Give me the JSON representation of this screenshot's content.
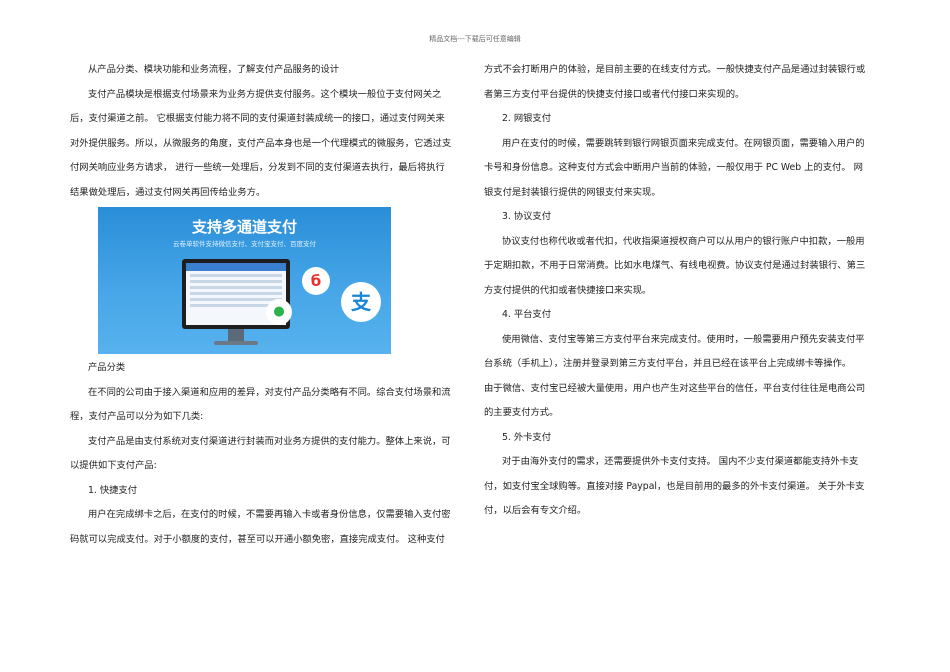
{
  "header": "精品文档---下载后可任意编辑",
  "left": [
    "从产品分类、模块功能和业务流程，了解支付产品服务的设计",
    "支付产品模块是根据支付场景来为业务方提供支付服务。这个模块一般位于支付网关之",
    "后，支付渠道之前。 它根据支付能力将不同的支付渠道封装成统一的接口，通过支付网关来",
    "对外提供服务。所以，从微服务的角度，支付产品本身也是一个代理模式的微服务，它透过支",
    "付网关响应业务方请求， 进行一些统一处理后，分发到不同的支付渠道去执行，最后将执行",
    "结果做处理后，通过支付网关再回传给业务方。",
    "产品分类",
    "在不同的公司由于接入渠道和应用的差异，对支付产品分类略有不同。综合支付场景和流",
    "程，支付产品可以分为如下几类:",
    "支付产品是由支付系统对支付渠道进行封装而对业务方提供的支付能力。整体上来说，可",
    "以提供如下支付产品:",
    "1. 快捷支付",
    "用户在完成绑卡之后，在支付的时候，不需要再输入卡或者身份信息，仅需要输入支付密",
    "码就可以完成支付。对于小额度的支付，甚至可以开通小额免密，直接完成支付。 这种支付"
  ],
  "figure": {
    "title": "支持多通道支付",
    "subtitle": "云卷单软件支持微信支付、支付宝支付、百度支付"
  },
  "right": [
    "方式不会打断用户的体验，是目前主要的在线支付方式。一般快捷支付产品是通过封装银行或",
    "者第三方支付平台提供的快捷支付接口或者代付接口来实现的。",
    "2. 网银支付",
    "用户在支付的时候，需要跳转到银行网银页面来完成支付。在网银页面，需要输入用户的",
    "卡号和身份信息。这种支付方式会中断用户当前的体验，一般仅用于 PC Web 上的支付。 网",
    "银支付是封装银行提供的网银支付来实现。",
    "3. 协议支付",
    "协议支付也称代收或者代扣，代收指渠道授权商户可以从用户的银行账户中扣款，一般用",
    "于定期扣款，不用于日常消费。比如水电煤气、有线电视费。协议支付是通过封装银行、第三",
    "方支付提供的代扣或者快捷接口来实现。",
    "4. 平台支付",
    "使用微信、支付宝等第三方支付平台来完成支付。使用时，一般需要用户预先安装支付平",
    "台系统（手机上），注册并登录到第三方支付平台，并且已经在该平台上完成绑卡等操作。",
    "由于微信、支付宝已经被大量使用，用户也产生对这些平台的信任，平台支付往往是电商公司",
    "的主要支付方式。",
    "5. 外卡支付",
    "对于由海外支付的需求，还需要提供外卡支付支持。 国内不少支付渠道都能支持外卡支",
    "付，如支付宝全球购等。直接对接 Paypal，也是目前用的最多的外卡支付渠道。 关于外卡支",
    "付，以后会有专文介绍。"
  ]
}
